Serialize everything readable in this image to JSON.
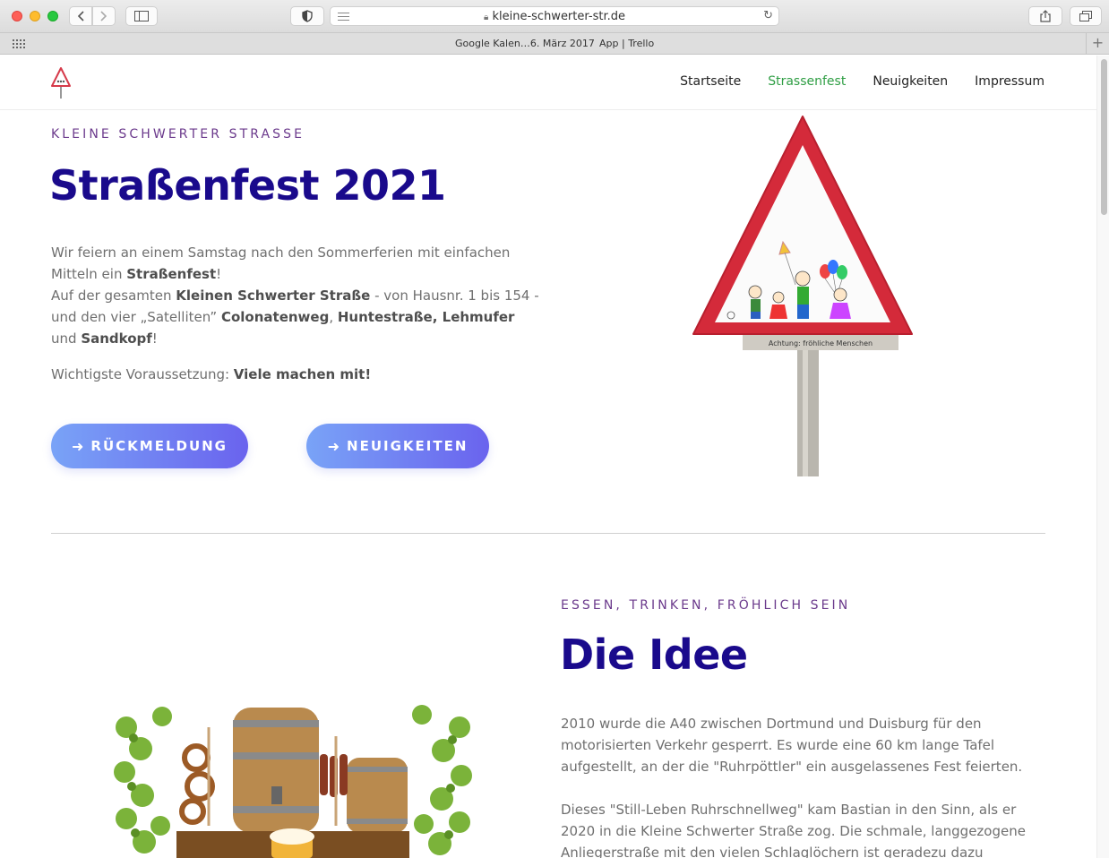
{
  "browser": {
    "url": "kleine-schwerter-str.de",
    "bookmarks": [
      "Google Kalen…6. März 2017",
      "App | Trello"
    ]
  },
  "nav": {
    "items": [
      {
        "label": "Startseite",
        "active": false
      },
      {
        "label": "Strassenfest",
        "active": true
      },
      {
        "label": "Neuigkeiten",
        "active": false
      },
      {
        "label": "Impressum",
        "active": false
      }
    ]
  },
  "hero": {
    "eyebrow": "KLEINE SCHWERTER STRASSE",
    "title": "Straßenfest 2021",
    "para1_a": "Wir feiern an einem Samstag nach den Sommerferien mit einfachen Mitteln ein ",
    "para1_b": "Straßenfest",
    "para1_c": "!",
    "para2_a": "Auf der gesamten ",
    "para2_b": "Kleinen Schwerter Straße",
    "para2_c": " - von Hausnr. 1 bis 154 - und den vier „Satelliten” ",
    "para2_d": "Colonatenweg",
    "para2_e": ", ",
    "para2_f": "Huntestraße, Lehmufer",
    "para2_g": " und ",
    "para2_h": "Sandkopf",
    "para2_i": "!",
    "para3_a": "Wichtigste Voraussetzung: ",
    "para3_b": "Viele machen mit!",
    "button1": "RÜCKMELDUNG",
    "button2": "NEUIGKEITEN",
    "sign_caption": "Achtung: fröhliche Menschen"
  },
  "idea": {
    "eyebrow": "ESSEN, TRINKEN, FRÖHLICH SEIN",
    "title": "Die Idee",
    "para1": "2010 wurde die A40 zwischen Dortmund und Duisburg für den motorisierten Verkehr gesperrt. Es wurde eine 60 km lange Tafel aufgestellt, an der die \"Ruhrpöttler\" ein ausgelassenes Fest feierten.",
    "para2": "Dieses \"Still-Leben Ruhrschnellweg\" kam Bastian in den Sinn, als er 2020 in die Kleine Schwerter Straße zog. Die schmale, langgezogene Anliegerstraße mit den vielen Schlaglöchern ist geradezu dazu prädestiniert, ihr für einen"
  },
  "colors": {
    "accent_green": "#2f9e44",
    "title_navy": "#1a0a8c",
    "eyebrow_purple": "#6b3a8c",
    "button_gradient": [
      "#79a3f7",
      "#6a63ee"
    ]
  }
}
